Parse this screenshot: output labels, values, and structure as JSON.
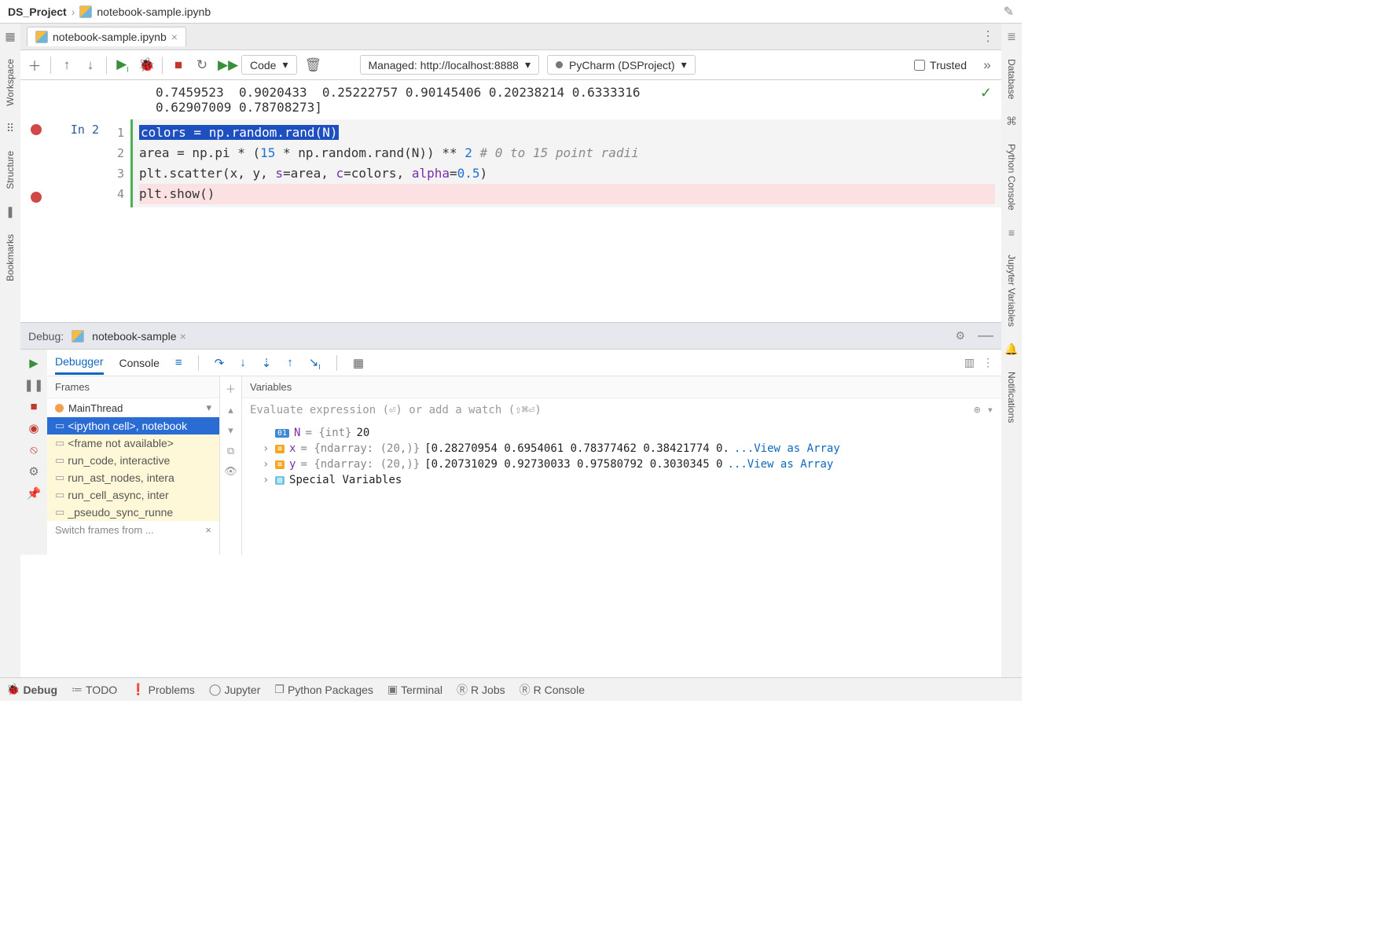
{
  "breadcrumb": {
    "project": "DS_Project",
    "file": "notebook-sample.ipynb"
  },
  "editor_tab": {
    "label": "notebook-sample.ipynb"
  },
  "toolbar": {
    "cell_type": "Code",
    "server": "Managed: http://localhost:8888",
    "interpreter": "PyCharm (DSProject)",
    "trusted_label": "Trusted"
  },
  "notebook": {
    "output_lines": [
      "0.7459523  0.9020433  0.25222757 0.90145406 0.20238214 0.6333316",
      "0.62907009 0.78708273]"
    ],
    "prompt": "In 2",
    "line_numbers": [
      "1",
      "2",
      "3",
      "4"
    ],
    "code": {
      "l1": "colors = np.random.rand(N)",
      "l2_pre": "area = np.pi * (",
      "l2_num1": "15",
      "l2_mid": " * np.random.rand(N)) ** ",
      "l2_num2": "2",
      "l2_cm": "# 0 to 15 point radii",
      "l3_pre": "plt.scatter(x, y, ",
      "l3_s": "s",
      "l3_eq1": "=area, ",
      "l3_c": "c",
      "l3_eq2": "=colors, ",
      "l3_a": "alpha",
      "l3_eq3": "=",
      "l3_val": "0.5",
      "l3_end": ")",
      "l4": "plt.show()"
    }
  },
  "debug": {
    "title": "Debug:",
    "tab": "notebook-sample",
    "tabs": {
      "debugger": "Debugger",
      "console": "Console"
    },
    "frames_title": "Frames",
    "vars_title": "Variables",
    "thread": "MainThread",
    "frames": [
      "<ipython cell>, notebook",
      "<frame not available>",
      "run_code, interactive",
      "run_ast_nodes, intera",
      "run_cell_async, inter",
      "_pseudo_sync_runne"
    ],
    "switch_hint": "Switch frames from ...",
    "eval_hint": "Evaluate expression (⏎) or add a watch (⇧⌘⏎)",
    "vars": {
      "n_name": "N",
      "n_type": " = {int} ",
      "n_val": "20",
      "x_name": "x",
      "x_type": " = {ndarray: (20,)} ",
      "x_val": "[0.28270954 0.6954061  0.78377462 0.38421774 0.",
      "y_name": "y",
      "y_type": " = {ndarray: (20,)} ",
      "y_val": "[0.20731029 0.92730033 0.97580792 0.3030345  0",
      "view_link": "...View as Array",
      "special": "Special Variables"
    }
  },
  "status": {
    "items": [
      "Debug",
      "TODO",
      "Problems",
      "Jupyter",
      "Python Packages",
      "Terminal",
      "R Jobs",
      "R Console"
    ]
  },
  "sidebar": {
    "left": [
      "Workspace",
      "Structure",
      "Bookmarks"
    ],
    "right": [
      "Database",
      "Python Console",
      "Jupyter Variables",
      "Notifications"
    ]
  }
}
